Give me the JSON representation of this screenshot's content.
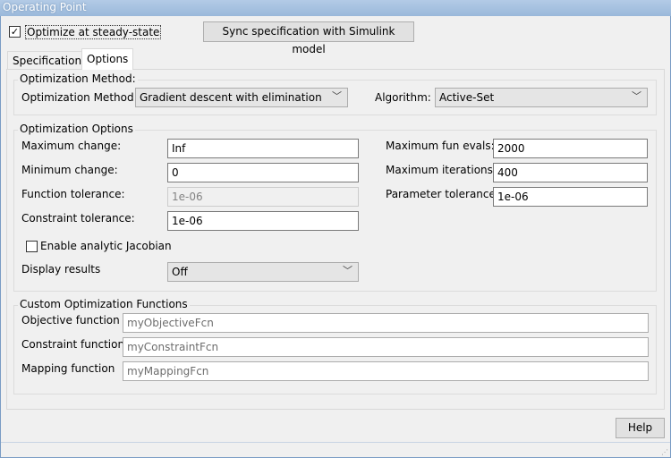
{
  "window": {
    "title": "Operating Point"
  },
  "top": {
    "optimize_checkbox": {
      "label": "Optimize at steady-state",
      "checked": true
    },
    "sync_button": "Sync specification with Simulink model"
  },
  "tabs": [
    {
      "label": "Specifications",
      "active": false
    },
    {
      "label": "Options",
      "active": true
    }
  ],
  "method_group": {
    "title": "Optimization Method:",
    "method_label": "Optimization Method:",
    "method_value": "Gradient descent with elimination",
    "algorithm_label": "Algorithm:",
    "algorithm_value": "Active-Set"
  },
  "options_group": {
    "title": "Optimization Options",
    "left": [
      {
        "label": "Maximum change:",
        "value": "Inf"
      },
      {
        "label": "Minimum change:",
        "value": "0"
      },
      {
        "label": "Function tolerance:",
        "value": "1e-06",
        "disabled": true
      },
      {
        "label": "Constraint tolerance:",
        "value": "1e-06"
      }
    ],
    "right": [
      {
        "label": "Maximum fun evals:",
        "value": "2000"
      },
      {
        "label": "Maximum iterations:",
        "value": "400"
      },
      {
        "label": "Parameter tolerance:",
        "value": "1e-06"
      }
    ],
    "jacobian": {
      "label": "Enable analytic Jacobian",
      "checked": false
    },
    "display": {
      "label": "Display results",
      "value": "Off"
    }
  },
  "custom_group": {
    "title": "Custom Optimization Functions",
    "rows": [
      {
        "label": "Objective function",
        "placeholder": "myObjectiveFcn"
      },
      {
        "label": "Constraint function",
        "placeholder": "myConstraintFcn"
      },
      {
        "label": "Mapping function",
        "placeholder": "myMappingFcn"
      }
    ]
  },
  "help_button": "Help"
}
